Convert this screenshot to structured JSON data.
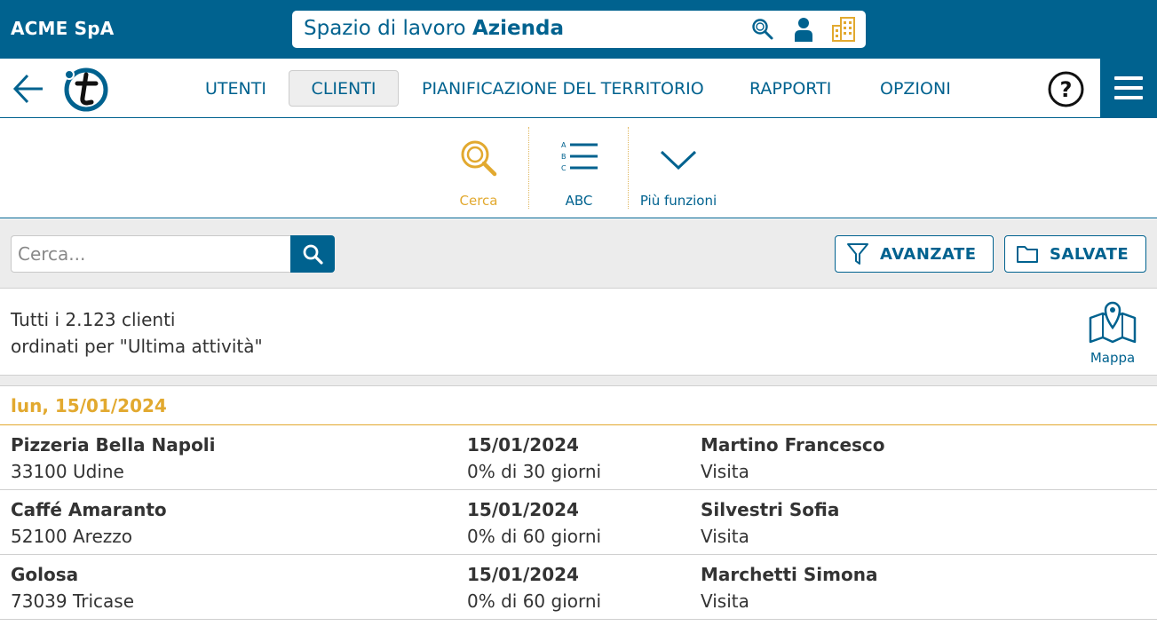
{
  "topbar": {
    "company": "ACME SpA",
    "workspace_prefix": "Spazio di lavoro",
    "workspace_name": "Azienda",
    "icons": [
      "search-icon",
      "user-icon",
      "building-icon"
    ]
  },
  "nav": {
    "tabs": [
      {
        "label": "UTENTI",
        "active": false
      },
      {
        "label": "CLIENTI",
        "active": true
      },
      {
        "label": "PIANIFICAZIONE DEL TERRITORIO",
        "active": false
      },
      {
        "label": "RAPPORTI",
        "active": false
      },
      {
        "label": "OPZIONI",
        "active": false
      }
    ],
    "help_glyph": "?"
  },
  "toolbar": {
    "items": [
      {
        "label": "Cerca",
        "icon": "magnifier-icon",
        "selected": true
      },
      {
        "label": "ABC",
        "icon": "abc-list-icon",
        "selected": false
      },
      {
        "label": "Più funzioni",
        "icon": "chevron-down-icon",
        "selected": false
      }
    ],
    "abc_letters": [
      "A",
      "B",
      "C"
    ]
  },
  "search": {
    "placeholder": "Cerca...",
    "value": "",
    "advanced_label": "AVANZATE",
    "saved_label": "SALVATE"
  },
  "summary": {
    "line1": "Tutti i 2.123 clienti",
    "line2": "ordinati per \"Ultima attività\"",
    "map_label": "Mappa"
  },
  "list": {
    "date_header": "lun, 15/01/2024",
    "rows": [
      {
        "name": "Pizzeria Bella Napoli",
        "address": "33100 Udine",
        "date": "15/01/2024",
        "progress": "0% di 30 giorni",
        "person": "Martino Francesco",
        "activity": "Visita"
      },
      {
        "name": "Caffé Amaranto",
        "address": "52100 Arezzo",
        "date": "15/01/2024",
        "progress": "0% di 60 giorni",
        "person": "Silvestri Sofia",
        "activity": "Visita"
      },
      {
        "name": "Golosa",
        "address": "73039 Tricase",
        "date": "15/01/2024",
        "progress": "0% di 60 giorni",
        "person": "Marchetti Simona",
        "activity": "Visita"
      }
    ]
  },
  "colors": {
    "primary": "#00628f",
    "accent": "#e2a92f",
    "text": "#333333",
    "panel": "#ececec"
  }
}
